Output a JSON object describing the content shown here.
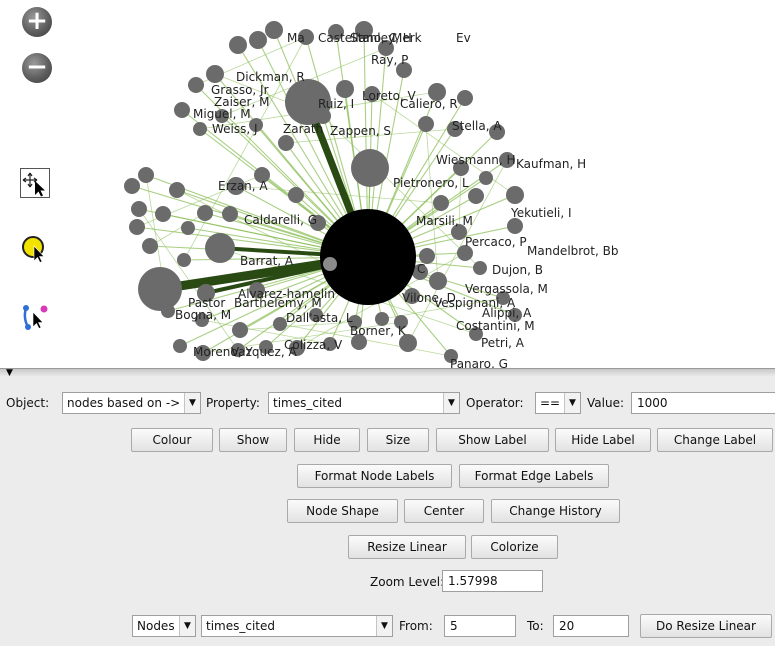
{
  "toolbar": {
    "zoom_in_glyph": "+",
    "zoom_out_glyph": "−"
  },
  "graph": {
    "colors": {
      "node": "#6b6b6b",
      "hub": "#000000",
      "edge_light": "#8cbf5a",
      "edge_dark": "#2a4a14"
    },
    "labels": [
      "Ma",
      "Castellano, C",
      "Stanley, H",
      "Merk",
      "Ev",
      "Ray, P",
      "Dickman, R",
      "Grasso, Jr",
      "Zaiser, M",
      "Miguel, M",
      "Weiss, J",
      "Zarath",
      "Ruiz, I",
      "Loreto, V",
      "Caliero, R",
      "Zappen, S",
      "Stella, A",
      "Wiesmann, H",
      "Kaufman, H",
      "Erzan, A",
      "Pietronero, L",
      "Yekutieli, I",
      "Caldarelli, G",
      "Marsili, M",
      "Percaco, P",
      "Mandelbrot, Bb",
      "Barrat, A",
      "C",
      "Dujon, B",
      "Vergassola, M",
      "Alvarez-hamelin",
      "Pastor",
      "Barthelemy, M",
      "Vilone, D",
      "Vespignani, A",
      "Bogna, M",
      "Dall'asta, L",
      "Alippi, A",
      "Costantini, M",
      "Borner, K",
      "Petri, A",
      "Moreno, Y",
      "Vazquez, A",
      "Colizza, V",
      "Panaro, G"
    ]
  },
  "panel": {
    "object_label": "Object:",
    "object_value": "nodes based on ->",
    "property_label": "Property:",
    "property_value": "times_cited",
    "operator_label": "Operator:",
    "operator_value": "==",
    "value_label": "Value:",
    "value_value": "1000",
    "buttons_row1": [
      "Colour",
      "Show",
      "Hide",
      "Size",
      "Show Label",
      "Hide Label",
      "Change Label"
    ],
    "buttons_row2": [
      "Format Node Labels",
      "Format Edge Labels"
    ],
    "buttons_row3": [
      "Node Shape",
      "Center",
      "Change History"
    ],
    "buttons_row4": [
      "Resize Linear",
      "Colorize"
    ],
    "zoom_label": "Zoom Level:",
    "zoom_value": "1.57998",
    "resize_type": "Nodes",
    "resize_property": "times_cited",
    "from_label": "From:",
    "from_value": "5",
    "to_label": "To:",
    "to_value": "20",
    "do_resize_label": "Do Resize Linear"
  }
}
